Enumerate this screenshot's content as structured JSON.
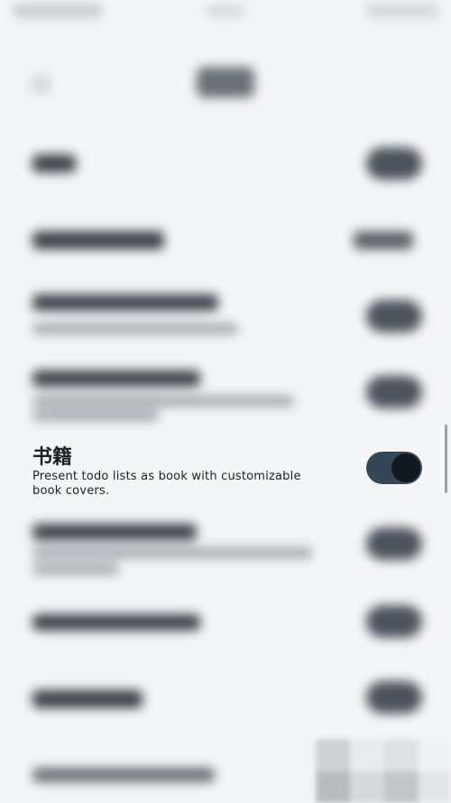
{
  "setting": {
    "title": "书籍",
    "description": "Present todo lists as book with customizable book covers.",
    "enabled": true
  }
}
